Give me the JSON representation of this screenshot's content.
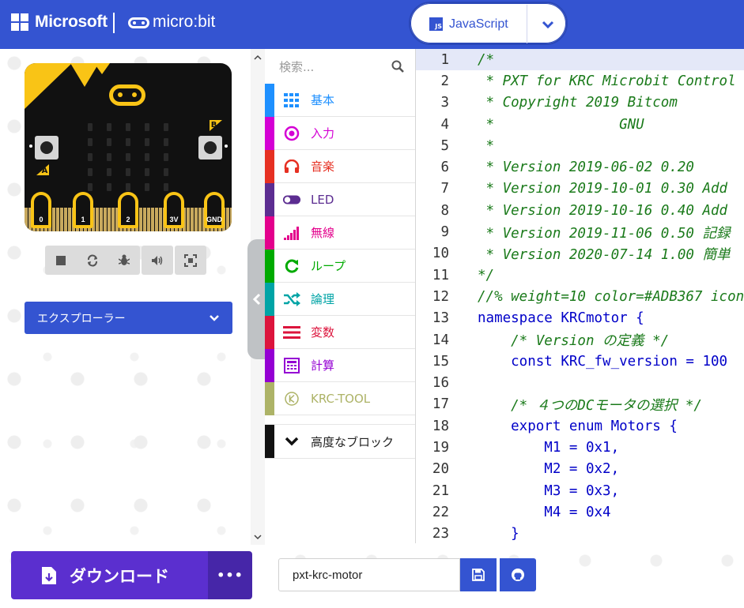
{
  "header": {
    "microsoft_label": "Microsoft",
    "microbit_label": "micro:bit",
    "language_label": "JavaScript",
    "colors": {
      "bar": "#3454d1"
    }
  },
  "simulator": {
    "pins": [
      "0",
      "1",
      "2",
      "3V",
      "GND"
    ],
    "button_a_label": "A",
    "button_b_label": "B",
    "toolbar_icons": [
      "stop-icon",
      "restart-icon",
      "debug-icon",
      "sound-icon",
      "fullscreen-icon"
    ],
    "explorer_label": "エクスプローラー"
  },
  "toolbox": {
    "search_placeholder": "検索...",
    "categories": [
      {
        "label": "基本",
        "color": "#1e90ff",
        "icon": "grid-icon"
      },
      {
        "label": "入力",
        "color": "#d400d4",
        "icon": "target-icon"
      },
      {
        "label": "音楽",
        "color": "#e63022",
        "icon": "headphones-icon"
      },
      {
        "label": "LED",
        "color": "#5c2d91",
        "icon": "toggle-icon"
      },
      {
        "label": "無線",
        "color": "#e3008c",
        "icon": "signal-icon"
      },
      {
        "label": "ループ",
        "color": "#00aa00",
        "icon": "loop-icon"
      },
      {
        "label": "論理",
        "color": "#00a4a6",
        "icon": "shuffle-icon"
      },
      {
        "label": "変数",
        "color": "#dc143c",
        "icon": "lines-icon"
      },
      {
        "label": "計算",
        "color": "#9400d3",
        "icon": "calculator-icon"
      },
      {
        "label": "KRC-TOOL",
        "color": "#adb367",
        "icon": "k-icon"
      }
    ],
    "advanced_label": "高度なブロック"
  },
  "editor": {
    "lines": [
      {
        "n": "1",
        "text": "/*"
      },
      {
        "n": "2",
        "text": " * PXT for KRC Microbit Control"
      },
      {
        "n": "3",
        "text": " * Copyright 2019 Bitcom"
      },
      {
        "n": "4",
        "text": " *               GNU"
      },
      {
        "n": "5",
        "text": " *"
      },
      {
        "n": "6",
        "text": " * Version 2019-06-02 0.20"
      },
      {
        "n": "7",
        "text": " * Version 2019-10-01 0.30 Add"
      },
      {
        "n": "8",
        "text": " * Version 2019-10-16 0.40 Add"
      },
      {
        "n": "9",
        "text": " * Version 2019-11-06 0.50 記録"
      },
      {
        "n": "10",
        "text": " * Version 2020-07-14 1.00 簡単"
      },
      {
        "n": "11",
        "text": "*/"
      },
      {
        "n": "12",
        "text": "//% weight=10 color=#ADB367 icon"
      },
      {
        "n": "13",
        "text": "namespace KRCmotor {"
      },
      {
        "n": "14",
        "text": "    /* Version の定義 */"
      },
      {
        "n": "15",
        "text": "    const KRC_fw_version = 100"
      },
      {
        "n": "16",
        "text": ""
      },
      {
        "n": "17",
        "text": "    /* ４つのDCモータの選択 */"
      },
      {
        "n": "18",
        "text": "    export enum Motors {"
      },
      {
        "n": "19",
        "text": "        M1 = 0x1,"
      },
      {
        "n": "20",
        "text": "        M2 = 0x2,"
      },
      {
        "n": "21",
        "text": "        M3 = 0x3,"
      },
      {
        "n": "22",
        "text": "        M4 = 0x4"
      },
      {
        "n": "23",
        "text": "    }"
      }
    ]
  },
  "footer": {
    "download_label": "ダウンロード",
    "more_label": "•••",
    "project_name": "pxt-krc-motor"
  }
}
